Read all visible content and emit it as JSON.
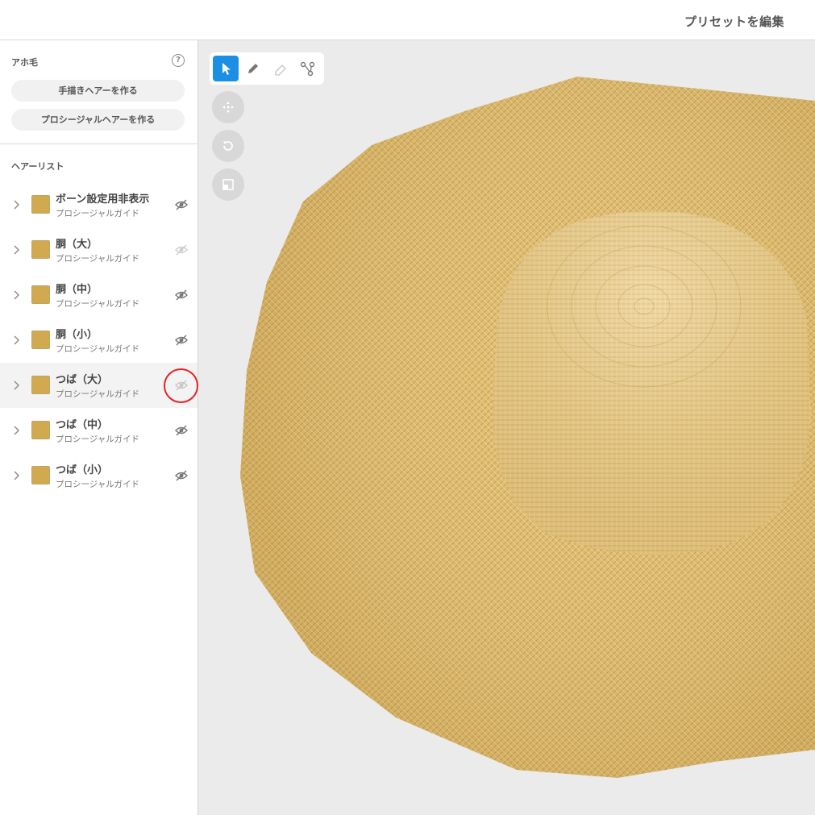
{
  "header": {
    "title": "プリセットを編集"
  },
  "sidebar": {
    "ahoge": {
      "label": "アホ毛",
      "help": "?",
      "buttons": [
        "手描きヘアーを作る",
        "プロシージャルヘアーを作る"
      ]
    },
    "hair_list": {
      "label": "ヘアーリスト",
      "items": [
        {
          "name": "ボーン設定用非表示",
          "subtitle": "プロシージャルガイド",
          "visible": false,
          "selected": false
        },
        {
          "name": "胴（大）",
          "subtitle": "プロシージャルガイド",
          "visible": false,
          "selected": false
        },
        {
          "name": "胴（中）",
          "subtitle": "プロシージャルガイド",
          "visible": false,
          "selected": false
        },
        {
          "name": "胴（小）",
          "subtitle": "プロシージャルガイド",
          "visible": false,
          "selected": false
        },
        {
          "name": "つば（大）",
          "subtitle": "プロシージャルガイド",
          "visible": false,
          "selected": true
        },
        {
          "name": "つば（中）",
          "subtitle": "プロシージャルガイド",
          "visible": false,
          "selected": false
        },
        {
          "name": "つば（小）",
          "subtitle": "プロシージャルガイド",
          "visible": false,
          "selected": false
        }
      ]
    }
  },
  "toolbar": {
    "tools": [
      "select-arrow-icon",
      "pen-icon",
      "eraser-icon",
      "bezier-node-icon"
    ],
    "active_tool": "select-arrow-icon",
    "view_buttons": [
      "move-icon",
      "rotate-icon",
      "fit-view-icon"
    ]
  },
  "colors": {
    "accent": "#1a8fe3",
    "swatch": "#d1a94f",
    "viewport_bg": "#ebebeb",
    "hat_straw": "#e0bd6e",
    "highlight": "#e3242b"
  }
}
